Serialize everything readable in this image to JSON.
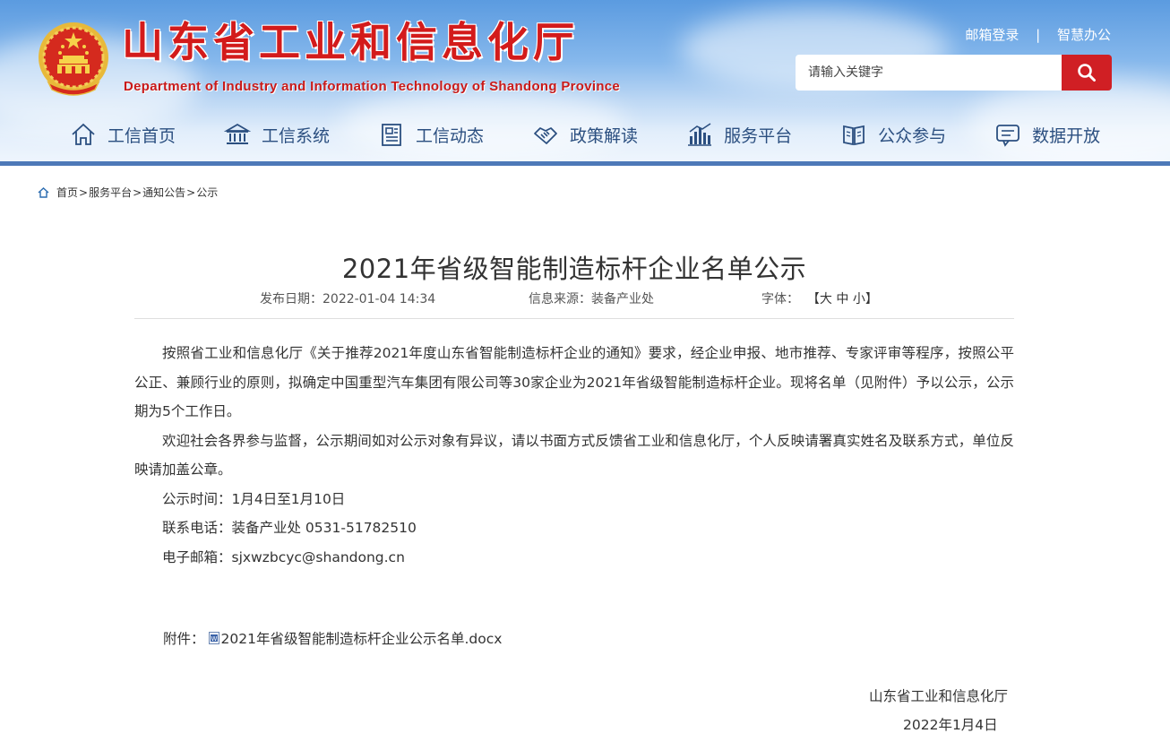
{
  "header": {
    "title": "山东省工业和信息化厅",
    "title_en": "Department of Industry and Information Technology of Shandong Province",
    "links": {
      "mail_login": "邮箱登录",
      "separator": "|",
      "smart_office": "智慧办公"
    },
    "search": {
      "placeholder": "请输入关键字",
      "icon": "search-icon"
    },
    "colors": {
      "brand_red": "#d01f24",
      "nav_text": "#2b4f80",
      "bar": "#4d79b8"
    }
  },
  "nav": {
    "items": [
      {
        "label": "工信首页",
        "icon": "home-icon"
      },
      {
        "label": "工信系统",
        "icon": "building-icon"
      },
      {
        "label": "工信动态",
        "icon": "newspaper-icon"
      },
      {
        "label": "政策解读",
        "icon": "handshake-icon"
      },
      {
        "label": "服务平台",
        "icon": "bar-chart-icon"
      },
      {
        "label": "公众参与",
        "icon": "book-icon"
      },
      {
        "label": "数据开放",
        "icon": "chat-icon"
      }
    ]
  },
  "breadcrumb": {
    "items": [
      "首页",
      "服务平台",
      "通知公告",
      "公示"
    ],
    "separator": ">"
  },
  "article": {
    "title": "2021年省级智能制造标杆企业名单公示",
    "meta": {
      "date_label": "发布日期：",
      "date": "2022-01-04 14:34",
      "source_label": "信息来源：",
      "source": "装备产业处",
      "font_label": "字体：",
      "font_open": "【",
      "font_large": "大",
      "font_medium": "中",
      "font_small": "小",
      "font_close": "】"
    },
    "paragraphs": [
      "按照省工业和信息化厅《关于推荐2021年度山东省智能制造标杆企业的通知》要求，经企业申报、地市推荐、专家评审等程序，按照公平公正、兼顾行业的原则，拟确定中国重型汽车集团有限公司等30家企业为2021年省级智能制造标杆企业。现将名单（见附件）予以公示，公示期为5个工作日。",
      "欢迎社会各界参与监督，公示期间如对公示对象有异议，请以书面方式反馈省工业和信息化厅，个人反映请署真实姓名及联系方式，单位反映请加盖公章。",
      "公示时间：1月4日至1月10日",
      "联系电话：装备产业处 0531-51782510",
      "电子邮箱：sjxwzbcyc@shandong.cn"
    ],
    "attachment": {
      "label": "附件：",
      "icon": "doc-icon",
      "filename": "2021年省级智能制造标杆企业公示名单.docx"
    },
    "signature": {
      "org": "山东省工业和信息化厅",
      "date": "2022年1月4日"
    }
  }
}
